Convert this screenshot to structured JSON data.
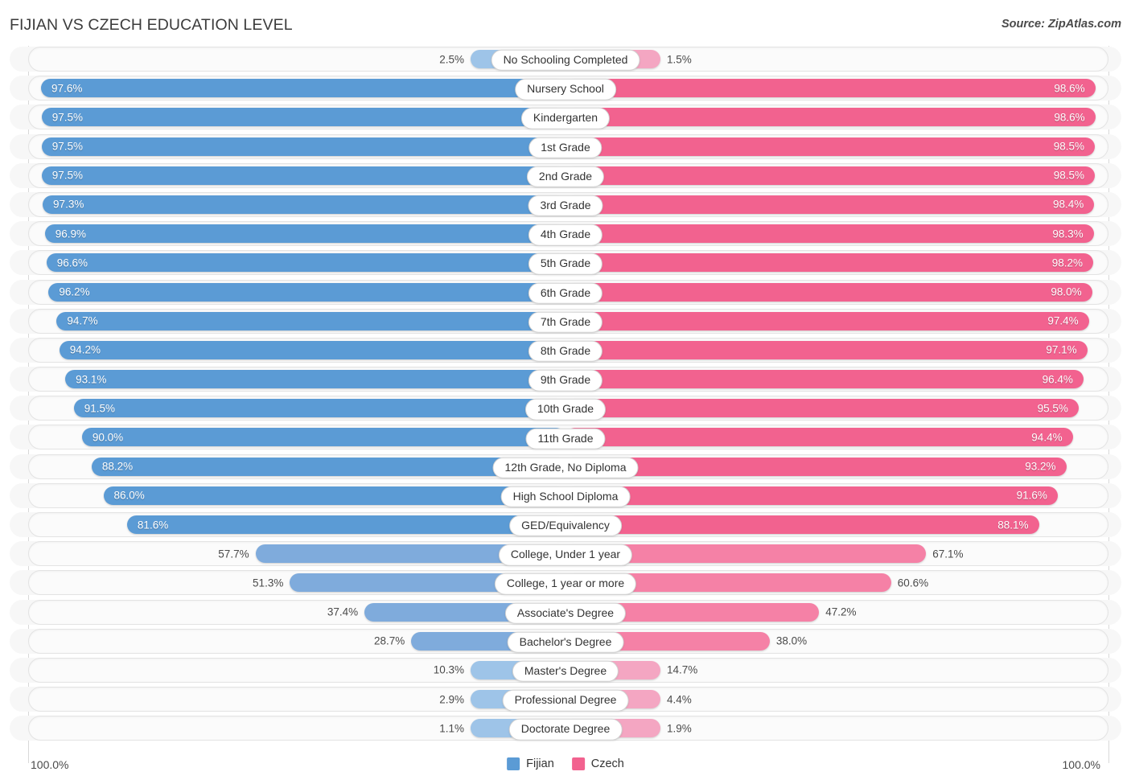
{
  "header": {
    "title": "FIJIAN VS CZECH EDUCATION LEVEL",
    "source": "Source: ZipAtlas.com"
  },
  "footer": {
    "left_axis_value": "100.0%",
    "right_axis_value": "100.0%",
    "legend": [
      {
        "label": "Fijian",
        "color": "#5b9bd5"
      },
      {
        "label": "Czech",
        "color": "#f2628f"
      }
    ]
  },
  "colors": {
    "fijian_strong": "#5b9bd5",
    "fijian_medium": "#7fabdc",
    "fijian_light": "#9ec4e8",
    "czech_strong": "#f2628f",
    "czech_medium": "#f581a6",
    "czech_light": "#f4a6c2",
    "track": "#fbfbfb",
    "band": "#f7f7f7"
  },
  "chart_data": {
    "type": "bar",
    "subtype": "diverging-bidirectional",
    "title": "FIJIAN VS CZECH EDUCATION LEVEL",
    "xlabel": "",
    "ylabel": "",
    "xlim": [
      0,
      100
    ],
    "axis_max_label": "100.0%",
    "grid": false,
    "legend_position": "bottom-center",
    "categories": [
      "No Schooling Completed",
      "Nursery School",
      "Kindergarten",
      "1st Grade",
      "2nd Grade",
      "3rd Grade",
      "4th Grade",
      "5th Grade",
      "6th Grade",
      "7th Grade",
      "8th Grade",
      "9th Grade",
      "10th Grade",
      "11th Grade",
      "12th Grade, No Diploma",
      "High School Diploma",
      "GED/Equivalency",
      "College, Under 1 year",
      "College, 1 year or more",
      "Associate's Degree",
      "Bachelor's Degree",
      "Master's Degree",
      "Professional Degree",
      "Doctorate Degree"
    ],
    "series": [
      {
        "name": "Fijian",
        "side": "left",
        "color": "#5b9bd5",
        "values": [
          2.5,
          97.6,
          97.5,
          97.5,
          97.5,
          97.3,
          96.9,
          96.6,
          96.2,
          94.7,
          94.2,
          93.1,
          91.5,
          90.0,
          88.2,
          86.0,
          81.6,
          57.7,
          51.3,
          37.4,
          28.7,
          10.3,
          2.9,
          1.1
        ],
        "labels": [
          "2.5%",
          "97.6%",
          "97.5%",
          "97.5%",
          "97.5%",
          "97.3%",
          "96.9%",
          "96.6%",
          "96.2%",
          "94.7%",
          "94.2%",
          "93.1%",
          "91.5%",
          "90.0%",
          "88.2%",
          "86.0%",
          "81.6%",
          "57.7%",
          "51.3%",
          "37.4%",
          "28.7%",
          "10.3%",
          "2.9%",
          "1.1%"
        ]
      },
      {
        "name": "Czech",
        "side": "right",
        "color": "#f2628f",
        "values": [
          1.5,
          98.6,
          98.6,
          98.5,
          98.5,
          98.4,
          98.3,
          98.2,
          98.0,
          97.4,
          97.1,
          96.4,
          95.5,
          94.4,
          93.2,
          91.6,
          88.1,
          67.1,
          60.6,
          47.2,
          38.0,
          14.7,
          4.4,
          1.9
        ],
        "labels": [
          "1.5%",
          "98.6%",
          "98.6%",
          "98.5%",
          "98.5%",
          "98.4%",
          "98.3%",
          "98.2%",
          "98.0%",
          "97.4%",
          "97.1%",
          "96.4%",
          "95.5%",
          "94.4%",
          "93.2%",
          "91.6%",
          "88.1%",
          "67.1%",
          "60.6%",
          "47.2%",
          "38.0%",
          "14.7%",
          "4.4%",
          "1.9%"
        ]
      }
    ]
  }
}
